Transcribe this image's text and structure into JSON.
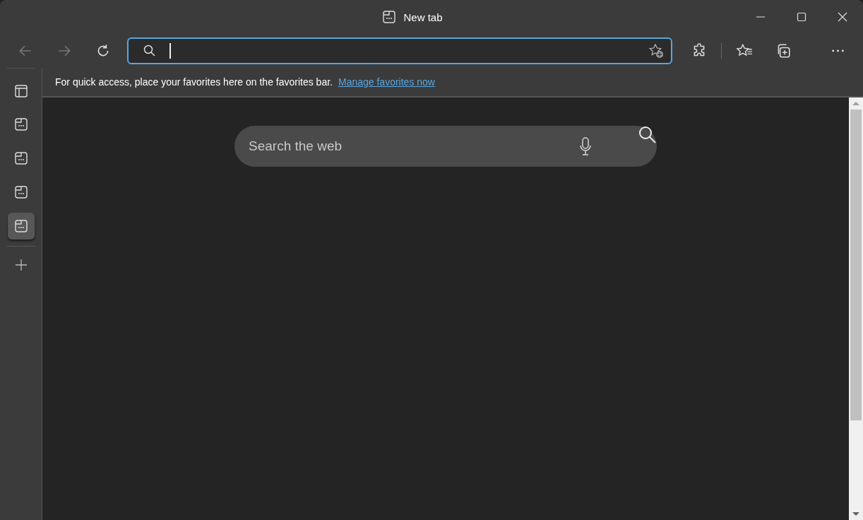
{
  "window": {
    "title": "New tab"
  },
  "address_bar": {
    "focused": true
  },
  "favorites_bar": {
    "message": "For quick access, place your favorites here on the favorites bar.",
    "link": "Manage favorites now"
  },
  "tabs": [
    {
      "selected": false
    },
    {
      "selected": false
    },
    {
      "selected": false
    },
    {
      "selected": true
    }
  ],
  "search": {
    "placeholder": "Search the web"
  }
}
